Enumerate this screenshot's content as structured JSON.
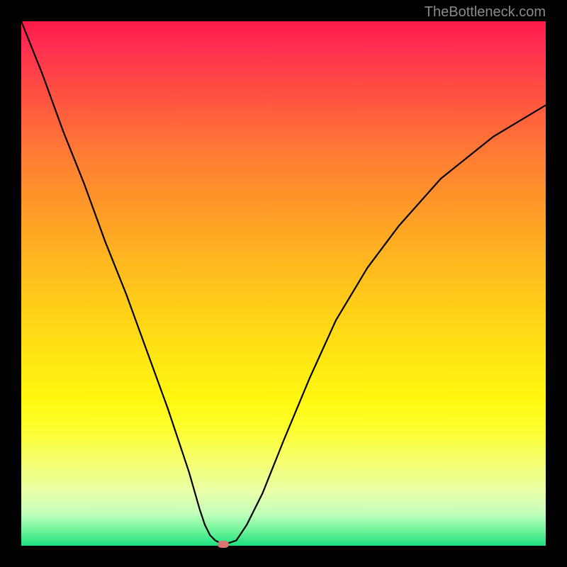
{
  "watermark": "TheBottleneck.com",
  "chart_data": {
    "type": "line",
    "title": "",
    "xlabel": "",
    "ylabel": "",
    "xlim": [
      0,
      100
    ],
    "ylim": [
      0,
      100
    ],
    "series": [
      {
        "name": "bottleneck-curve",
        "x": [
          0,
          4,
          8,
          12,
          16,
          20,
          24,
          28,
          32,
          34,
          35,
          36,
          37,
          38,
          39.5,
          41,
          43,
          46,
          50,
          55,
          60,
          66,
          72,
          80,
          90,
          100
        ],
        "y": [
          100,
          90,
          79,
          69,
          58,
          48,
          37,
          26,
          14,
          7,
          4,
          2,
          1,
          0.5,
          0.5,
          1,
          4,
          10,
          20,
          32,
          43,
          53,
          61,
          70,
          78,
          84
        ]
      }
    ],
    "marker": {
      "x": 38.5,
      "y": 0.3
    },
    "background_gradient": {
      "stops": [
        {
          "pos": 0,
          "color": "#ff1a4a"
        },
        {
          "pos": 50,
          "color": "#ffd018"
        },
        {
          "pos": 78,
          "color": "#fdff30"
        },
        {
          "pos": 100,
          "color": "#1ee080"
        }
      ]
    }
  }
}
